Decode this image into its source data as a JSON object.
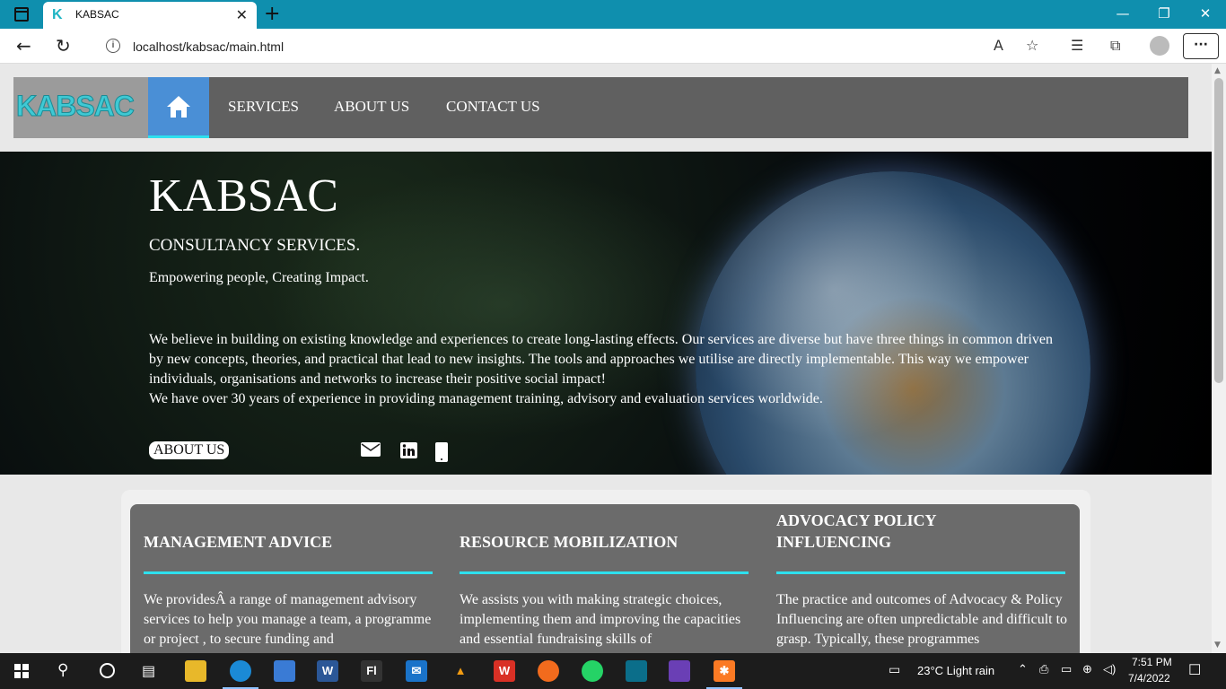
{
  "browser": {
    "tab_title": "KABSAC",
    "tab_favicon": "K",
    "url": "localhost/kabsac/main.html"
  },
  "site": {
    "logo_text": "KABSAC",
    "nav": [
      "SERVICES",
      "ABOUT US",
      "CONTACT US"
    ]
  },
  "hero": {
    "title": "KABSAC",
    "subtitle": "CONSULTANCY SERVICES.",
    "tagline": "Empowering people, Creating Impact.",
    "body_1": "We believe in building on existing knowledge and experiences to create long-lasting effects. Our services are diverse but have three things in common driven by new concepts, theories, and practical that lead to new insights. The tools and approaches we utilise are directly implementable. This way we empower individuals, organisations and networks to increase their positive social impact!",
    "body_2": "We have over 30 years of experience in providing management training, advisory and evaluation services worldwide.",
    "about_button": "ABOUT US"
  },
  "services": [
    {
      "title": "MANAGEMENT ADVICE",
      "text": "We providesÂ a range of management advisory services to help you manage a team, a programme or project , to secure funding and"
    },
    {
      "title": "RESOURCE MOBILIZATION",
      "text": "We assists you with making strategic choices, implementing them and improving the capacities and essential fundraising skills of"
    },
    {
      "title": "ADVOCACY POLICY INFLUENCING",
      "text": "The practice and outcomes of Advocacy & Policy Influencing are often unpredictable and difficult to grasp. Typically, these programmes"
    }
  ],
  "taskbar": {
    "weather": "23°C  Light rain",
    "time": "7:51 PM",
    "date": "7/4/2022"
  },
  "colors": {
    "titlebar": "#0f8fae",
    "accent": "#2ee0ee",
    "home": "#4a8fd6",
    "nav": "#606060"
  }
}
